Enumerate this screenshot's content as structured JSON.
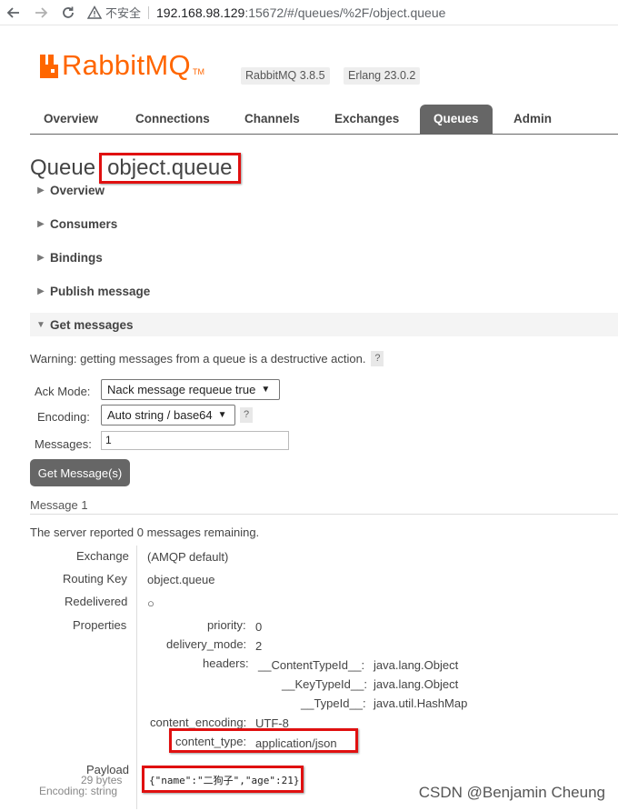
{
  "browser": {
    "insecure_label": "不安全",
    "url_host": "192.168.98.129",
    "url_rest": ":15672/#/queues/%2F/object.queue"
  },
  "header": {
    "logo_text": "RabbitMQ",
    "logo_tm": "TM",
    "rabbitmq_version": "RabbitMQ 3.8.5",
    "erlang_version": "Erlang 23.0.2",
    "brand_color": "#ff6600"
  },
  "tabs": [
    "Overview",
    "Connections",
    "Channels",
    "Exchanges",
    "Queues",
    "Admin"
  ],
  "active_tab": "Queues",
  "page": {
    "title_prefix": "Queue",
    "queue_name": "object.queue"
  },
  "sections": [
    "Overview",
    "Consumers",
    "Bindings",
    "Publish message",
    "Get messages"
  ],
  "get_messages": {
    "warning": "Warning: getting messages from a queue is a destructive action.",
    "help": "?",
    "ack_mode_label": "Ack Mode:",
    "ack_mode_value": "Nack message requeue true",
    "encoding_label": "Encoding:",
    "encoding_value": "Auto string / base64",
    "messages_label": "Messages:",
    "messages_value": "1",
    "button": "Get Message(s)"
  },
  "message": {
    "heading": "Message 1",
    "remaining": "The server reported 0 messages remaining.",
    "exchange_label": "Exchange",
    "exchange_value": "(AMQP default)",
    "routing_key_label": "Routing Key",
    "routing_key_value": "object.queue",
    "redelivered_label": "Redelivered",
    "redelivered_value": "○",
    "properties_label": "Properties",
    "priority_label": "priority:",
    "priority_value": "0",
    "delivery_mode_label": "delivery_mode:",
    "delivery_mode_value": "2",
    "headers_label": "headers:",
    "content_type_id_label": "__ContentTypeId__:",
    "content_type_id_value": "java.lang.Object",
    "key_type_id_label": "__KeyTypeId__:",
    "key_type_id_value": "java.lang.Object",
    "type_id_label": "__TypeId__:",
    "type_id_value": "java.util.HashMap",
    "content_encoding_label": "content_encoding:",
    "content_encoding_value": "UTF-8",
    "content_type_label": "content_type:",
    "content_type_value": "application/json",
    "payload_label": "Payload",
    "payload_size": "29 bytes",
    "payload_encoding": "Encoding: string",
    "payload_value": "{\"name\":\"二狗子\",\"age\":21}"
  },
  "watermark": "CSDN @Benjamin Cheung",
  "highlight_color": "#e01010"
}
